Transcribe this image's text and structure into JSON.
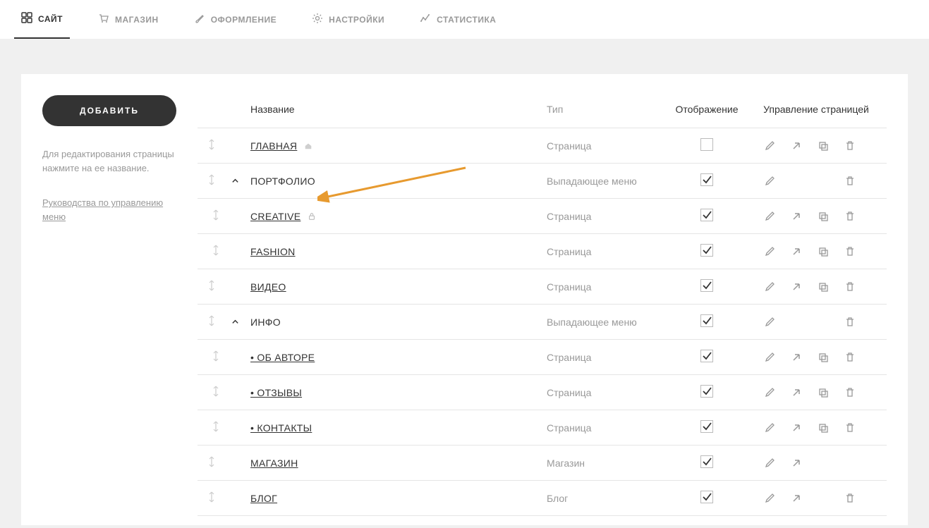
{
  "topnav": {
    "items": [
      {
        "id": "site",
        "label": "САЙТ",
        "active": true,
        "icon": "grid"
      },
      {
        "id": "shop",
        "label": "МАГАЗИН",
        "active": false,
        "icon": "cart"
      },
      {
        "id": "design",
        "label": "ОФОРМЛЕНИЕ",
        "active": false,
        "icon": "brush"
      },
      {
        "id": "settings",
        "label": "НАСТРОЙКИ",
        "active": false,
        "icon": "gear"
      },
      {
        "id": "stats",
        "label": "СТАТИСТИКА",
        "active": false,
        "icon": "stats"
      }
    ]
  },
  "sidebar": {
    "add_button": "ДОБАВИТЬ",
    "help_text": "Для редактирования страницы нажмите на ее название.",
    "guide_link": "Руководства по управлению меню"
  },
  "table": {
    "headers": {
      "name": "Название",
      "type": "Тип",
      "visibility": "Отображение",
      "manage": "Управление страницей"
    },
    "rows": [
      {
        "name": "ГЛАВНАЯ",
        "link": true,
        "type": "Страница",
        "level": 0,
        "expandable": false,
        "checked": false,
        "home": true,
        "lock": false,
        "actions": [
          "edit",
          "open",
          "copy",
          "delete"
        ]
      },
      {
        "name": "ПОРТФОЛИО",
        "link": false,
        "type": "Выпадающее меню",
        "level": 0,
        "expandable": true,
        "checked": true,
        "home": false,
        "lock": false,
        "actions": [
          "edit",
          "",
          "",
          "delete"
        ]
      },
      {
        "name": "CREATIVE",
        "link": true,
        "type": "Страница",
        "level": 1,
        "expandable": false,
        "checked": true,
        "home": false,
        "lock": true,
        "actions": [
          "edit",
          "open",
          "copy",
          "delete"
        ]
      },
      {
        "name": "FASHION",
        "link": true,
        "type": "Страница",
        "level": 1,
        "expandable": false,
        "checked": true,
        "home": false,
        "lock": false,
        "actions": [
          "edit",
          "open",
          "copy",
          "delete"
        ]
      },
      {
        "name": "ВИДЕО",
        "link": true,
        "type": "Страница",
        "level": 0,
        "expandable": false,
        "checked": true,
        "home": false,
        "lock": false,
        "actions": [
          "edit",
          "open",
          "copy",
          "delete"
        ]
      },
      {
        "name": "ИНФО",
        "link": false,
        "type": "Выпадающее меню",
        "level": 0,
        "expandable": true,
        "checked": true,
        "home": false,
        "lock": false,
        "actions": [
          "edit",
          "",
          "",
          "delete"
        ]
      },
      {
        "name": "• ОБ АВТОРЕ",
        "link": true,
        "type": "Страница",
        "level": 1,
        "expandable": false,
        "checked": true,
        "home": false,
        "lock": false,
        "actions": [
          "edit",
          "open",
          "copy",
          "delete"
        ]
      },
      {
        "name": "• ОТЗЫВЫ",
        "link": true,
        "type": "Страница",
        "level": 1,
        "expandable": false,
        "checked": true,
        "home": false,
        "lock": false,
        "actions": [
          "edit",
          "open",
          "copy",
          "delete"
        ]
      },
      {
        "name": "• КОНТАКТЫ",
        "link": true,
        "type": "Страница",
        "level": 1,
        "expandable": false,
        "checked": true,
        "home": false,
        "lock": false,
        "actions": [
          "edit",
          "open",
          "copy",
          "delete"
        ]
      },
      {
        "name": "МАГАЗИН",
        "link": true,
        "type": "Магазин",
        "level": 0,
        "expandable": false,
        "checked": true,
        "home": false,
        "lock": false,
        "actions": [
          "edit",
          "open",
          "",
          ""
        ]
      },
      {
        "name": "БЛОГ",
        "link": true,
        "type": "Блог",
        "level": 0,
        "expandable": false,
        "checked": true,
        "home": false,
        "lock": false,
        "actions": [
          "edit",
          "open",
          "",
          "delete"
        ]
      }
    ]
  },
  "annotation": {
    "arrow_color": "#e79a2f"
  }
}
